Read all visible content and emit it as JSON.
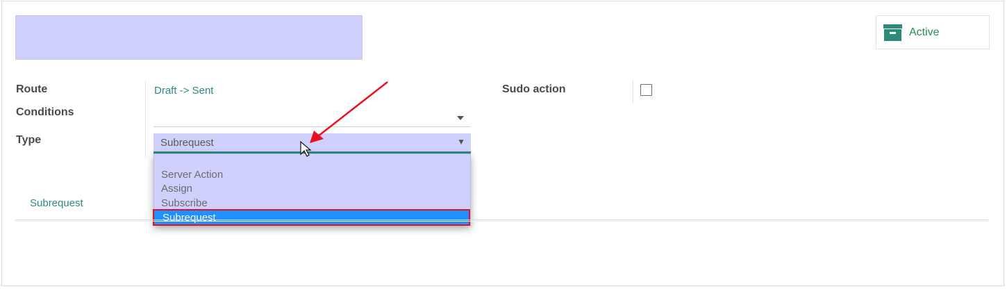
{
  "status_button": {
    "label": "Active",
    "icon": "archive-box-icon",
    "color": "#2e8b57"
  },
  "fields": {
    "route": {
      "label": "Route",
      "value": "Draft -> Sent"
    },
    "conditions": {
      "label": "Conditions",
      "value": ""
    },
    "type": {
      "label": "Type",
      "value": "Subrequest",
      "options": [
        "",
        "Server Action",
        "Assign",
        "Subscribe",
        "Subrequest"
      ],
      "highlighted_option": "Subrequest"
    },
    "sudo_action": {
      "label": "Sudo action",
      "checked": false
    }
  },
  "tabs": [
    {
      "label": "Subrequest"
    }
  ],
  "colors": {
    "highlight_bg": "#cfd0fc",
    "accent": "#2b8c7e",
    "selected_option_bg": "#1e90ff",
    "annotation_red": "#e8101e"
  }
}
